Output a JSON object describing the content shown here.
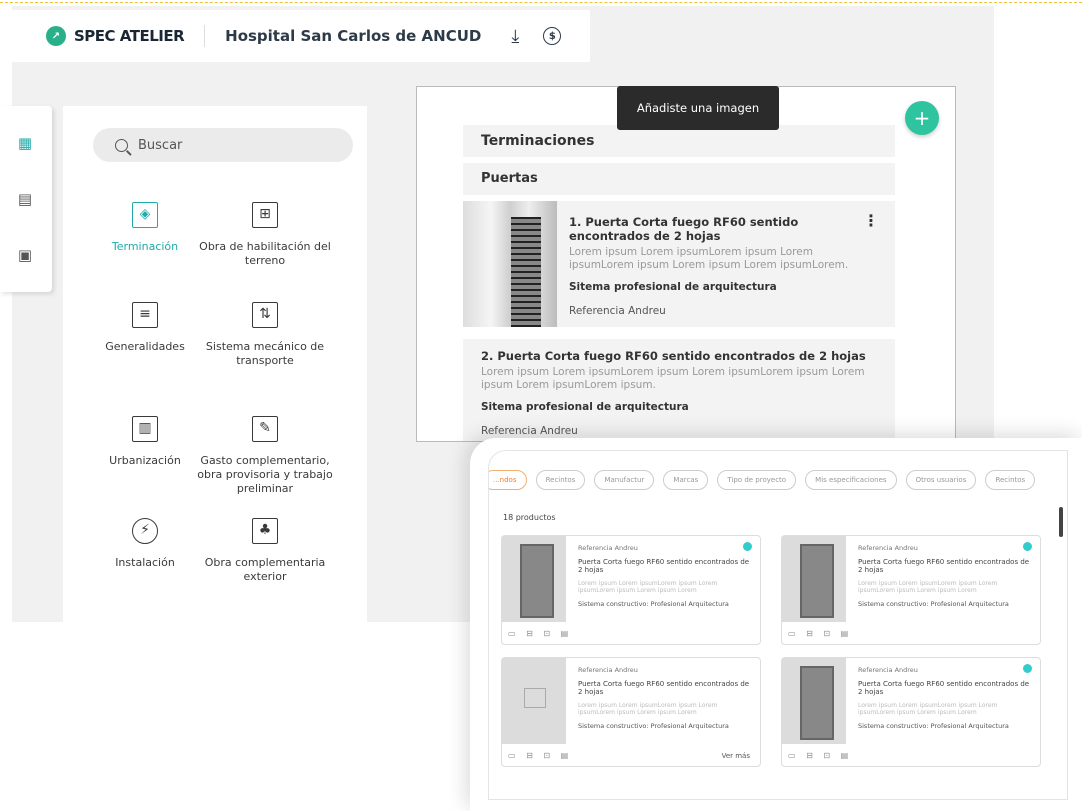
{
  "header": {
    "brand": "SPEC ATELIER",
    "project": "Hospital San Carlos de ANCUD"
  },
  "sidebar_icons": [
    "blueprint-icon",
    "document-icon",
    "catalog-icon"
  ],
  "categories": {
    "search_placeholder": "Buscar",
    "items": [
      {
        "label": "Terminación",
        "selected": true
      },
      {
        "label": "Obra de habilitación del terreno"
      },
      {
        "label": "Generalidades"
      },
      {
        "label": "Sistema mecánico de transporte"
      },
      {
        "label": "Urbanización"
      },
      {
        "label": "Gasto complementario, obra provisoria y trabajo preliminar"
      },
      {
        "label": "Instalación"
      },
      {
        "label": "Obra complementaria exterior"
      }
    ]
  },
  "document": {
    "section": "Terminaciones",
    "subsection": "Puertas",
    "items": [
      {
        "title": "1. Puerta Corta fuego RF60 sentido encontrados de 2 hojas",
        "desc": "Lorem ipsum Lorem ipsumLorem ipsum Lorem ipsumLorem ipsum Lorem ipsum Lorem ipsumLorem.",
        "system": "Sitema profesional de arquitectura",
        "ref": "Referencia Andreu"
      },
      {
        "title": "2. Puerta Corta fuego RF60 sentido encontrados de 2 hojas",
        "desc": "Lorem ipsum Lorem ipsumLorem ipsum Lorem ipsumLorem ipsum Lorem ipsum Lorem ipsumLorem ipsum.",
        "system": "Sitema profesional de arquitectura",
        "ref": "Referencia Andreu"
      }
    ]
  },
  "toast": "Añadiste una imagen",
  "fab": "+",
  "overlay": {
    "chips": [
      "...ndos",
      "Recintos",
      "Manufactur",
      "Marcas",
      "Tipo de proyecto",
      "Mis especificaciones",
      "Otros usuarios",
      "Recintos"
    ],
    "count": "18 productos",
    "cards": [
      {
        "ref": "Referencia Andreu",
        "title": "Puerta Corta fuego RF60 sentido encontrados de 2 hojas",
        "desc": "Lorem ipsum Lorem ipsumLorem ipsum Lorem ipsumLorem ipsum Lorem ipsum Lorem",
        "system": "Sistema constructivo: Profesional Arquitectura",
        "checked": true,
        "photo": true
      },
      {
        "ref": "Referencia Andreu",
        "title": "Puerta Corta fuego RF60 sentido encontrados de 2 hojas",
        "desc": "Lorem ipsum Lorem ipsumLorem ipsum Lorem ipsumLorem ipsum Lorem ipsum Lorem",
        "system": "Sistema constructivo: Profesional Arquitectura",
        "checked": true,
        "photo": true
      },
      {
        "ref": "Referencia Andreu",
        "title": "Puerta Corta fuego RF60 sentido encontrados de 2 hojas",
        "desc": "Lorem ipsum Lorem ipsumLorem ipsum Lorem ipsumLorem ipsum Lorem ipsum Lorem",
        "system": "Sistema constructivo: Profesional Arquitectura",
        "checked": false,
        "photo": false,
        "more": "Ver más"
      },
      {
        "ref": "Referencia Andreu",
        "title": "Puerta Corta fuego RF60 sentido encontrados de 2 hojas",
        "desc": "Lorem ipsum Lorem ipsumLorem ipsum Lorem ipsumLorem ipsum Lorem ipsum Lorem",
        "system": "Sistema constructivo: Profesional Arquitectura",
        "checked": true,
        "photo": true
      }
    ]
  },
  "colors": {
    "accent": "#2ec4a0",
    "teal": "#22aaaa",
    "toast_bg": "#2b2b2b"
  }
}
